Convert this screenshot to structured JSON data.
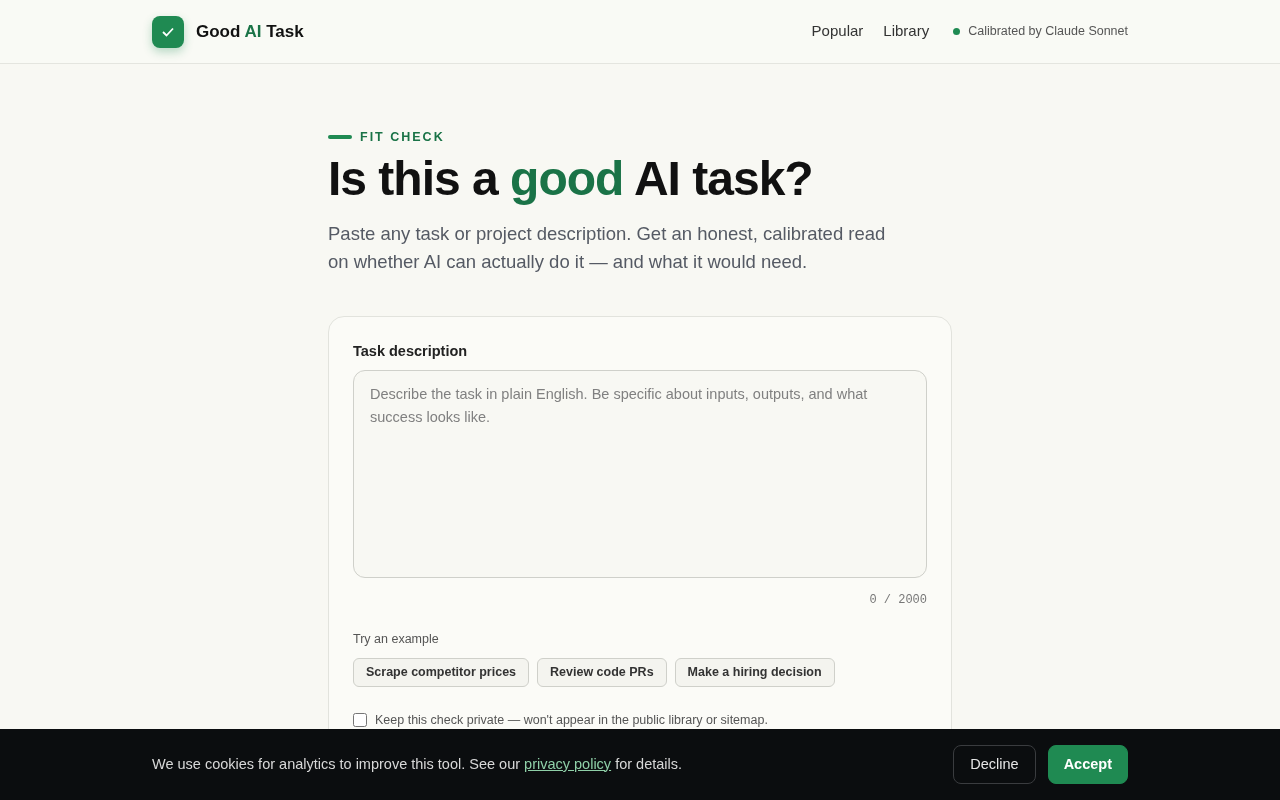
{
  "header": {
    "logo_parts": [
      {
        "text": "Good ",
        "accent": false
      },
      {
        "text": "AI",
        "accent": true
      },
      {
        "text": " Task",
        "accent": false
      }
    ],
    "nav": [
      {
        "label": "Popular"
      },
      {
        "label": "Library"
      }
    ],
    "status": {
      "text": "Calibrated by Claude Sonnet",
      "color": "#1f8a52"
    }
  },
  "hero": {
    "eyebrow": "FIT CHECK",
    "title_parts": [
      {
        "text": "Is this a ",
        "accent": false
      },
      {
        "text": "good",
        "accent": true
      },
      {
        "text": " AI task?",
        "accent": false
      }
    ],
    "subtitle": "Paste any task or project description. Get an honest, calibrated read on whether AI can actually do it — and what it would need."
  },
  "form": {
    "label": "Task description",
    "placeholder": "Describe the task in plain English. Be specific about inputs, outputs, and what success looks like.",
    "counter": "0 / 2000",
    "examples_label": "Try an example",
    "examples": [
      "Scrape competitor prices",
      "Review code PRs",
      "Make a hiring decision"
    ],
    "private": {
      "label": "Keep this check private — won't appear in the public library or sitemap.",
      "checked": false
    }
  },
  "cookie_banner": {
    "text_before": "We use cookies for analytics to improve this tool. See our",
    "link": "privacy policy",
    "text_after": "for details.",
    "buttons": [
      {
        "label": "Decline",
        "kind": "secondary"
      },
      {
        "label": "Accept",
        "kind": "primary"
      }
    ]
  }
}
